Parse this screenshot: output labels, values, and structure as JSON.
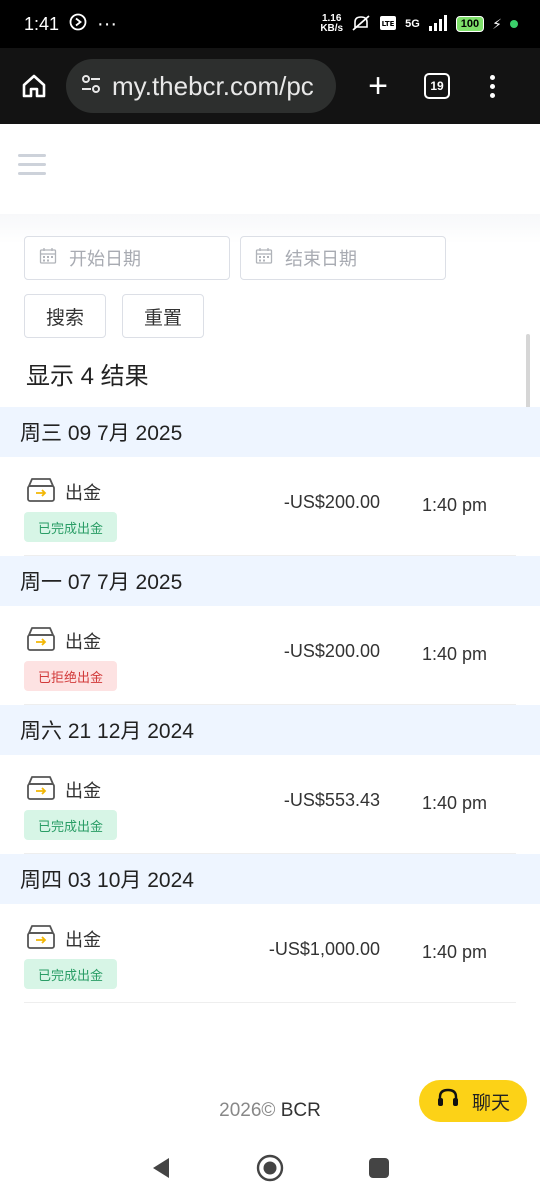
{
  "status_bar": {
    "time": "1:41",
    "more": "···",
    "speed_value": "1.16",
    "speed_unit": "KB/s",
    "network": "5G",
    "battery": "100"
  },
  "browser": {
    "url": "my.thebcr.com/pc",
    "tab_count": "19"
  },
  "filters": {
    "start_date_placeholder": "开始日期",
    "end_date_placeholder": "结束日期",
    "search_label": "搜索",
    "reset_label": "重置"
  },
  "results": {
    "count_label": "显示 4 结果"
  },
  "groups": [
    {
      "date": "周三 09 7月 2025",
      "type": "出金",
      "status": "已完成出金",
      "status_kind": "ok",
      "amount": "-US$200.00",
      "time": "1:40 pm"
    },
    {
      "date": "周一 07 7月 2025",
      "type": "出金",
      "status": "已拒绝出金",
      "status_kind": "reject",
      "amount": "-US$200.00",
      "time": "1:40 pm"
    },
    {
      "date": "周六 21 12月 2024",
      "type": "出金",
      "status": "已完成出金",
      "status_kind": "ok",
      "amount": "-US$553.43",
      "time": "1:40 pm"
    },
    {
      "date": "周四 03 10月 2024",
      "type": "出金",
      "status": "已完成出金",
      "status_kind": "ok",
      "amount": "-US$1,000.00",
      "time": "1:40 pm"
    }
  ],
  "footer": {
    "copyright": "2026©",
    "brand": "BCR"
  },
  "chat": {
    "label": "聊天"
  },
  "colors": {
    "accent_yellow": "#fcd217",
    "success_bg": "#d7f5e6",
    "success_text": "#2a9d66",
    "reject_bg": "#fde2e2",
    "reject_text": "#d23b3b",
    "date_header_bg": "#eef5ff"
  },
  "icons": {
    "home": "home-icon",
    "site_settings": "tune-icon",
    "calendar": "calendar-icon",
    "withdraw": "withdraw-box-icon",
    "chat": "headset-icon"
  }
}
